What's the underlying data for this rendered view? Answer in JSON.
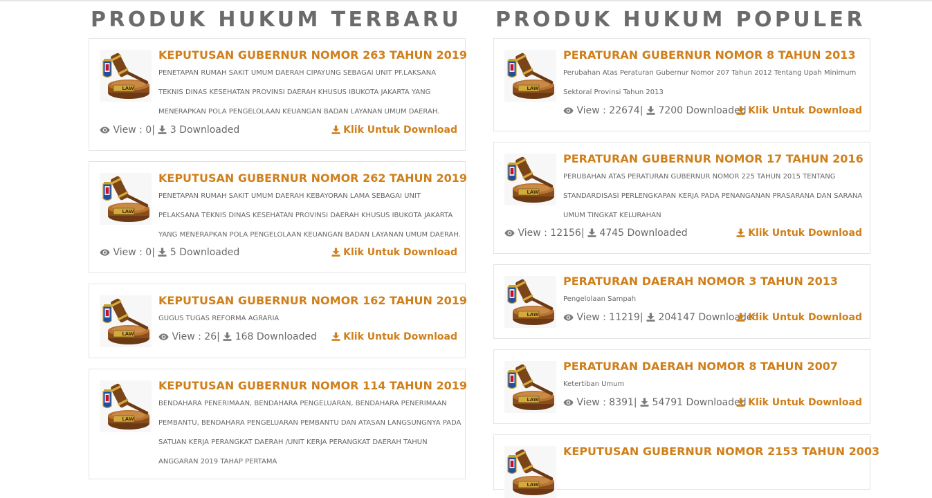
{
  "terbaru": {
    "heading": "PRODUK HUKUM TERBARU",
    "items": [
      {
        "title": "KEPUTUSAN GUBERNUR NOMOR 263 TAHUN 2019",
        "description": "PENETAPAN RUMAH SAKIT UMUM DAERAH CIPAYUNG SEBAGAI UNIT PF.LAKSANA TEKNIS DINAS KESEHATAN PROVINSI DAERAH KHUSUS IBUKOTA JAKARTA YANG MENERAPKAN POLA PENGELOLAAN KEUANGAN BADAN LAYANAN UMUM DAERAH.",
        "views": "View : 0|",
        "downloads": "3 Downloaded",
        "download_label": "Klik Untuk Download"
      },
      {
        "title": "KEPUTUSAN GUBERNUR NOMOR 262 TAHUN 2019",
        "description": "PENETAPAN RUMAH SAKIT UMUM DAERAH KEBAYORAN LAMA SEBAGAI UNIT PELAKSANA TEKNIS DINAS KESEHATAN PROVINSI DAERAH KHUSUS IBUKOTA JAKARTA YANG MENERAPKAN POLA PENGELOLAAN KEUANGAN BADAN LAYANAN UMUM DAERAH.",
        "views": "View : 0|",
        "downloads": "5 Downloaded",
        "download_label": "Klik Untuk Download"
      },
      {
        "title": "KEPUTUSAN GUBERNUR NOMOR 162 TAHUN 2019",
        "description": "GUGUS TUGAS REFORMA AGRARIA",
        "views": "View : 26|",
        "downloads": "168 Downloaded",
        "download_label": "Klik Untuk Download"
      },
      {
        "title": "KEPUTUSAN GUBERNUR NOMOR 114 TAHUN 2019",
        "description": "BENDAHARA PENERIMAAN, BENDAHARA PENGELUARAN, BENDAHARA PENERIMAAN PEMBANTU, BENDAHARA PENGELUARAN PEMBANTU DAN ATASAN LANGSUNGNYA PADA SATUAN KERJA PERANGKAT DAERAH /UNIT KERJA PERANGKAT DAERAH TAHUN ANGGARAN 2019 TAHAP PERTAMA",
        "views": "",
        "downloads": "",
        "download_label": ""
      }
    ]
  },
  "populer": {
    "heading": "PRODUK HUKUM POPULER",
    "items": [
      {
        "title": "PERATURAN GUBERNUR NOMOR 8 TAHUN 2013",
        "description": "Perubahan Atas Peraturan Gubernur Nomor 207 Tahun 2012 Tentang Upah Minimum Sektoral Provinsi Tahun 2013",
        "views": "View : 22674|",
        "downloads": "7200 Downloaded",
        "download_label": "Klik Untuk Download"
      },
      {
        "title": "PERATURAN GUBERNUR NOMOR 17 TAHUN 2016",
        "description": "PERUBAHAN ATAS PERATURAN GUBERNUR NOMOR 225 TAHUN 2015 TENTANG STANDARDISASI PERLENGKAPAN KERJA PADA PENANGANAN PRASARANA DAN SARANA UMUM TINGKAT KELURAHAN",
        "views": "View : 12156|",
        "downloads": "4745 Downloaded",
        "download_label": "Klik Untuk Download"
      },
      {
        "title": "PERATURAN DAERAH NOMOR 3 TAHUN 2013",
        "description": "Pengelolaan Sampah",
        "views": "View : 11219|",
        "downloads": "204147 Downloaded",
        "download_label": "Klik Untuk Download"
      },
      {
        "title": "PERATURAN DAERAH NOMOR 8 TAHUN 2007",
        "description": "Ketertiban Umum",
        "views": "View : 8391|",
        "downloads": "54791 Downloaded",
        "download_label": "Klik Untuk Download"
      },
      {
        "title": "KEPUTUSAN GUBERNUR NOMOR 2153 TAHUN 2003",
        "description": "",
        "views": "",
        "downloads": "",
        "download_label": ""
      }
    ]
  },
  "thumbnail_label": "LAW",
  "colors": {
    "accent": "#d07f1a",
    "heading": "#6b6b6b",
    "text": "#6a6a6a",
    "border": "#e3e3e3"
  },
  "icons": {
    "views": "eye-icon",
    "downloads": "download-icon",
    "download_link": "download-icon"
  }
}
